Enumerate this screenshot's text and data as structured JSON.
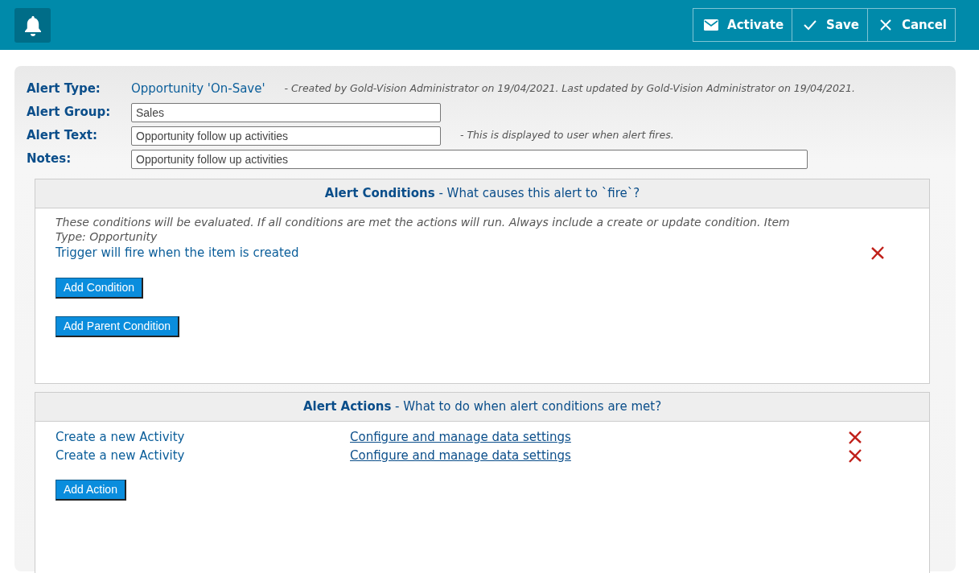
{
  "toolbar": {
    "buttons": [
      {
        "kind": "mail",
        "label": "Activate"
      },
      {
        "kind": "check",
        "label": "Save"
      },
      {
        "kind": "close",
        "label": "Cancel"
      }
    ]
  },
  "form": {
    "alert_type": {
      "label": "Alert Type:",
      "value": "Opportunity 'On-Save'",
      "note": "- Created by Gold-Vision Administrator on 19/04/2021. Last updated by Gold-Vision Administrator on 19/04/2021."
    },
    "fields": [
      {
        "label": "Alert Group:",
        "value": "Sales",
        "kind": "short"
      },
      {
        "label": "Alert Text:",
        "value": "Opportunity follow up activities",
        "kind": "short",
        "note": "- This is displayed to user when alert fires."
      },
      {
        "label": "Notes:",
        "value": "Opportunity follow up activities",
        "kind": "long"
      }
    ]
  },
  "conditions": {
    "title": "Alert Conditions",
    "subtitle": "- What causes this alert to `fire`?",
    "description": "These conditions will be evaluated.  If all conditions are met the actions will run. Always include a create or update condition. Item Type: Opportunity",
    "items": [
      {
        "text": "Trigger will fire when the item is created"
      }
    ],
    "buttons": [
      "Add Condition",
      "Add Parent Condition"
    ]
  },
  "actions": {
    "title": "Alert Actions",
    "subtitle": "- What to do when alert conditions are met?",
    "items": [
      {
        "text": "Create a new Activity",
        "link": "Configure and manage data settings"
      },
      {
        "text": "Create a new Activity",
        "link": "Configure and manage data settings"
      }
    ],
    "buttons": [
      "Add Action"
    ]
  }
}
